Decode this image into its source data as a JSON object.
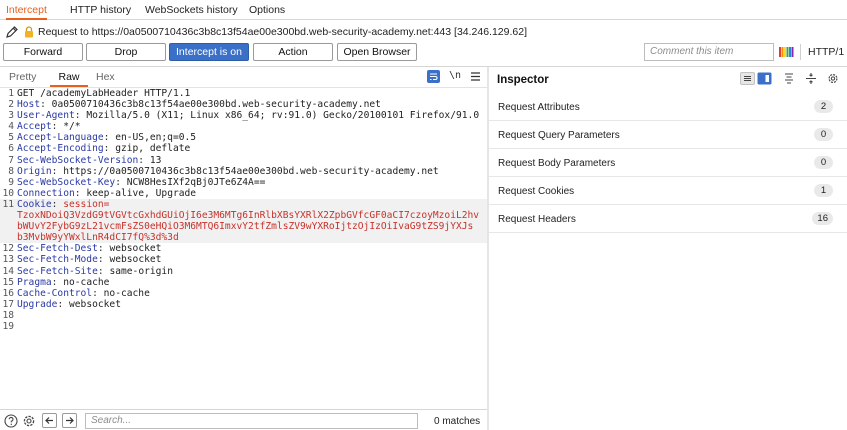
{
  "top_tabs": [
    {
      "label": "Intercept",
      "active": true
    },
    {
      "label": "HTTP history",
      "active": false
    },
    {
      "label": "WebSockets history",
      "active": false
    },
    {
      "label": "Options",
      "active": false
    }
  ],
  "request_line": "Request to https://0a0500710436c3b8c13f54ae00e300bd.web-security-academy.net:443  [34.246.129.62]",
  "toolbar": {
    "forward_label": "Forward",
    "drop_label": "Drop",
    "intercept_label": "Intercept is on",
    "action_label": "Action",
    "open_browser_label": "Open Browser",
    "comment_placeholder": "Comment this item",
    "http_version": "HTTP/1"
  },
  "editor": {
    "view_tabs": [
      {
        "label": "Pretty",
        "active": false
      },
      {
        "label": "Raw",
        "active": true
      },
      {
        "label": "Hex",
        "active": false
      }
    ],
    "newline_toggle_label": "\\n",
    "lines": [
      {
        "n": "1",
        "text": "GET /academyLabHeader HTTP/1.1"
      },
      {
        "n": "2",
        "name": "Host",
        "value": "0a0500710436c3b8c13f54ae00e300bd.web-security-academy.net"
      },
      {
        "n": "3",
        "name": "User-Agent",
        "value": "Mozilla/5.0 (X11; Linux x86_64; rv:91.0) Gecko/20100101 Firefox/91.0"
      },
      {
        "n": "4",
        "name": "Accept",
        "value": "*/*"
      },
      {
        "n": "5",
        "name": "Accept-Language",
        "value": "en-US,en;q=0.5"
      },
      {
        "n": "6",
        "name": "Accept-Encoding",
        "value": "gzip, deflate"
      },
      {
        "n": "7",
        "name": "Sec-WebSocket-Version",
        "value": "13"
      },
      {
        "n": "8",
        "name": "Origin",
        "value": "https://0a0500710436c3b8c13f54ae00e300bd.web-security-academy.net"
      },
      {
        "n": "9",
        "name": "Sec-WebSocket-Key",
        "value": "NCW8HesIXf2qBj0JTe6Z4A=="
      },
      {
        "n": "10",
        "name": "Connection",
        "value": "keep-alive, Upgrade"
      },
      {
        "n": "11",
        "name": "Cookie",
        "value": "session=",
        "highlight": true
      },
      {
        "n": "",
        "cookie": "TzoxNDoiQ3VzdG9tVGVtcGxhdGUiOjI6e3M6MTg6InRlbXBsYXRlX2ZpbGVfcGF0aCI7czoyMzoiL2hv",
        "highlight": true
      },
      {
        "n": "",
        "cookie": "bWUvY2FybG9zL21vcmFsZS0eHQiO3M6MTQ6ImxvY2tfZmlsZV9wYXRoIjtzOjIzOiIvaG9tZS9jYXJs",
        "highlight": true
      },
      {
        "n": "",
        "cookie": "b3MvbW9yYWxlLnR4dCI7fQ%3d%3d",
        "highlight": true
      },
      {
        "n": "12",
        "name": "Sec-Fetch-Dest",
        "value": "websocket"
      },
      {
        "n": "13",
        "name": "Sec-Fetch-Mode",
        "value": "websocket"
      },
      {
        "n": "14",
        "name": "Sec-Fetch-Site",
        "value": "same-origin"
      },
      {
        "n": "15",
        "name": "Pragma",
        "value": "no-cache"
      },
      {
        "n": "16",
        "name": "Cache-Control",
        "value": "no-cache"
      },
      {
        "n": "17",
        "name": "Upgrade",
        "value": "websocket"
      },
      {
        "n": "18",
        "text": ""
      },
      {
        "n": "19",
        "text": ""
      }
    ]
  },
  "inspector": {
    "title": "Inspector",
    "rows": [
      {
        "label": "Request Attributes",
        "count": "2"
      },
      {
        "label": "Request Query Parameters",
        "count": "0"
      },
      {
        "label": "Request Body Parameters",
        "count": "0"
      },
      {
        "label": "Request Cookies",
        "count": "1"
      },
      {
        "label": "Request Headers",
        "count": "16"
      }
    ]
  },
  "search": {
    "placeholder": "Search...",
    "matches": "0 matches"
  },
  "colors": {
    "accent_orange": "#e8601c",
    "button_blue": "#3b70c9",
    "header_name_blue": "#2a3aa5",
    "cookie_red": "#c6322c"
  },
  "icons": [
    "pencil-icon",
    "lock-icon",
    "highlighter-icon",
    "wrap-lines-icon",
    "newline-icon",
    "menu-icon",
    "list-view-icon",
    "panel-view-icon",
    "sort-icon",
    "align-icon",
    "gear-icon",
    "help-icon",
    "settings-icon",
    "back-arrow-icon",
    "forward-arrow-icon"
  ]
}
